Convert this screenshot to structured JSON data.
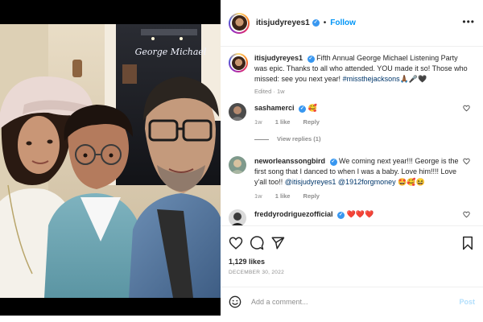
{
  "post": {
    "photo_sign_text": "George Michael",
    "author": {
      "username": "itisjudyreyes1",
      "follow_label": "Follow",
      "separator": "•",
      "more_label": "•••"
    },
    "caption": {
      "username": "itisjudyreyes1",
      "text": "Fifth Annual George Michael Listening Party was epic. Thanks to all who attended. YOU made it so! Those who missed: see you next year!",
      "hashtag": "#missthejacksons",
      "emojis": "🙏🏾🎤🖤",
      "edited": "Edited",
      "age": "1w"
    },
    "comments": [
      {
        "username": "sashamerci",
        "text": "",
        "emojis": "🥰",
        "age": "1w",
        "likes": "1 like",
        "reply_label": "Reply",
        "view_replies": "View replies (1)"
      },
      {
        "username": "neworleanssongbird",
        "text": "We coming next year!!! George is the first song that I danced to when I was a baby. Love him!!!! Love y'all too!!",
        "mentions": "@itisjudyreyes1 @1912forgmoney",
        "emojis": "🤩🥰😆",
        "age": "1w",
        "likes": "1 like",
        "reply_label": "Reply"
      },
      {
        "username": "freddyrodriguezofficial",
        "emojis": "❤️❤️❤️"
      }
    ],
    "likes_count": "1,129 likes",
    "date": "DECEMBER 30, 2022",
    "comment_placeholder": "Add a comment...",
    "post_label": "Post",
    "verified_mark": "✓"
  },
  "colors": {
    "accent": "#0095f6",
    "muted": "#8e8e8e",
    "text": "#262626",
    "verified": "#3897f0",
    "post_disabled": "#b2dffc"
  },
  "icons": [
    "heart-icon",
    "comment-icon",
    "share-icon",
    "bookmark-icon",
    "emoji-icon",
    "verified-icon",
    "more-icon"
  ]
}
